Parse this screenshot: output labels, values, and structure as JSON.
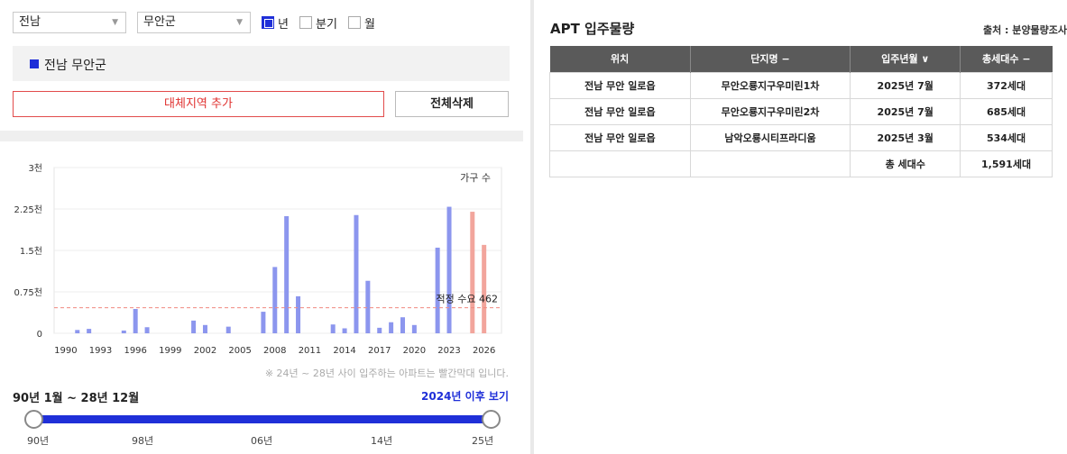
{
  "filters": {
    "province": "전남",
    "city": "무안군",
    "period_options": [
      {
        "label": "년",
        "checked": true
      },
      {
        "label": "분기",
        "checked": false
      },
      {
        "label": "월",
        "checked": false
      }
    ]
  },
  "region_list": [
    "전남 무안군"
  ],
  "buttons": {
    "add_region": "대체지역 추가",
    "delete_all": "전체삭제"
  },
  "chart_data": {
    "type": "bar",
    "legend_text": "가구 수",
    "y_ticks": [
      "0",
      "0.75천",
      "1.5천",
      "2.25천",
      "3천"
    ],
    "ylim": [
      0,
      3000
    ],
    "x_ticks": [
      "1990",
      "1993",
      "1996",
      "1999",
      "2002",
      "2005",
      "2008",
      "2011",
      "2014",
      "2017",
      "2020",
      "2023",
      "2026"
    ],
    "xlim": [
      1989,
      2027.5
    ],
    "reference_line": {
      "label": "적정 수요 462",
      "value": 462
    },
    "highlight_color": "#f2a59c",
    "bar_color": "#8c96ee",
    "points": [
      {
        "year": 1991,
        "value": 60
      },
      {
        "year": 1992,
        "value": 80
      },
      {
        "year": 1995,
        "value": 50
      },
      {
        "year": 1996,
        "value": 440
      },
      {
        "year": 1997,
        "value": 110
      },
      {
        "year": 2001,
        "value": 230
      },
      {
        "year": 2002,
        "value": 150
      },
      {
        "year": 2004,
        "value": 120
      },
      {
        "year": 2007,
        "value": 390
      },
      {
        "year": 2008,
        "value": 1200
      },
      {
        "year": 2009,
        "value": 2120
      },
      {
        "year": 2010,
        "value": 670
      },
      {
        "year": 2013,
        "value": 160
      },
      {
        "year": 2014,
        "value": 90
      },
      {
        "year": 2015,
        "value": 2140
      },
      {
        "year": 2016,
        "value": 950
      },
      {
        "year": 2017,
        "value": 100
      },
      {
        "year": 2018,
        "value": 200
      },
      {
        "year": 2019,
        "value": 290
      },
      {
        "year": 2020,
        "value": 150
      },
      {
        "year": 2022,
        "value": 1550
      },
      {
        "year": 2023,
        "value": 2290
      },
      {
        "year": 2025,
        "value": 2200,
        "highlight": true
      },
      {
        "year": 2026,
        "value": 1600,
        "highlight": true
      }
    ]
  },
  "note": "※ 24년 ~ 28년 사이 입주하는 아파트는 빨간막대 입니다.",
  "range": {
    "label": "90년 1월 ~ 28년 12월",
    "after_link": "2024년 이후 보기",
    "slider_ticks": [
      "90년",
      "98년",
      "06년",
      "14년",
      "25년"
    ]
  },
  "apt": {
    "title": "APT 입주물량",
    "source": "출처 : 분양물량조사",
    "columns": [
      "위치",
      "단지명 −",
      "입주년월 ∨",
      "총세대수 −"
    ],
    "rows": [
      [
        "전남 무안 일로읍",
        "무안오룡지구우미린1차",
        "2025년 7월",
        "372세대"
      ],
      [
        "전남 무안 일로읍",
        "무안오룡지구우미린2차",
        "2025년 7월",
        "685세대"
      ],
      [
        "전남 무안 일로읍",
        "남악오룡시티프라디움",
        "2025년 3월",
        "534세대"
      ]
    ],
    "total_label": "총 세대수",
    "total_value": "1,591세대"
  }
}
